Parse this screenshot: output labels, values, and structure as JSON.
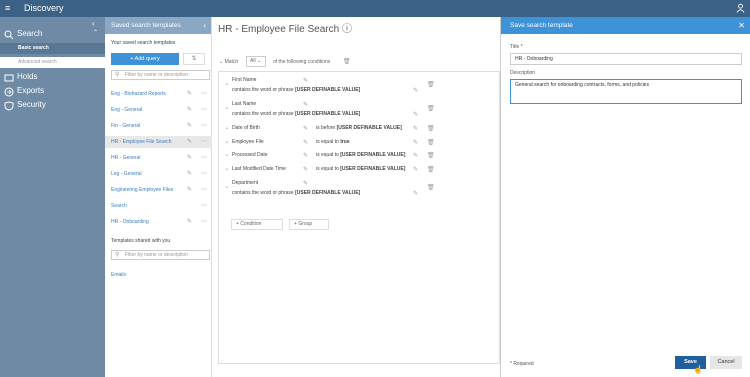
{
  "app": {
    "title": "Discovery"
  },
  "sidebar": {
    "search_label": "Search",
    "basic_search": "Basic search",
    "advanced_search": "Advanced search",
    "holds_label": "Holds",
    "exports_label": "Exports",
    "security_label": "Security"
  },
  "templates": {
    "header": "Saved search templates",
    "your_label": "Your saved search templates",
    "add_query": "Add query",
    "filter_placeholder": "Filter by name or description",
    "items": [
      "Eng - Biohazard Reports",
      "Eng - General",
      "Fin - General",
      "HR - Employee File Search",
      "HR - General",
      "Leg - General",
      "Engineering Employee Files",
      "Search",
      "HR - Onboarding"
    ],
    "shared_label": "Templates shared with you",
    "shared_filter_placeholder": "Filter by name or description",
    "shared_items": [
      "Emails"
    ]
  },
  "main": {
    "title": "HR - Employee File Search",
    "match": "Match",
    "all": "All",
    "following": "of the following conditions",
    "conditions": [
      {
        "field": "First Name",
        "sub": "contains the word or phrase",
        "value": "[USER DEFINABLE VALUE]"
      },
      {
        "field": "Last Name",
        "sub": "contains the word or phrase",
        "value": "[USER DEFINABLE VALUE]"
      },
      {
        "field": "Date of Birth",
        "op": "is before",
        "value": "[USER DEFINABLE VALUE]"
      },
      {
        "field": "Employee File",
        "op": "is equal to",
        "value": "true"
      },
      {
        "field": "Processed Date",
        "op": "is equal to",
        "value": "[USER DEFINABLE VALUE]"
      },
      {
        "field": "Last Modified Date Time",
        "op": "is equal to",
        "value": "[USER DEFINABLE VALUE]"
      },
      {
        "field": "Department",
        "sub": "contains the word or phrase",
        "value": "[USER DEFINABLE VALUE]"
      }
    ],
    "add_condition": "Condition",
    "add_group": "Group"
  },
  "panel": {
    "header": "Save search template",
    "title_label": "Title *",
    "title_value": "HR - Onboarding",
    "desc_label": "Description",
    "desc_value": "General search for onboarding contracts, forms, and policies",
    "required": "* Required",
    "save": "Save",
    "cancel": "Cancel"
  },
  "colors": {
    "topbar": "#3b6286",
    "sidebar": "#6e8aa5",
    "accent": "#3e93d8",
    "save": "#1f5f9e"
  }
}
